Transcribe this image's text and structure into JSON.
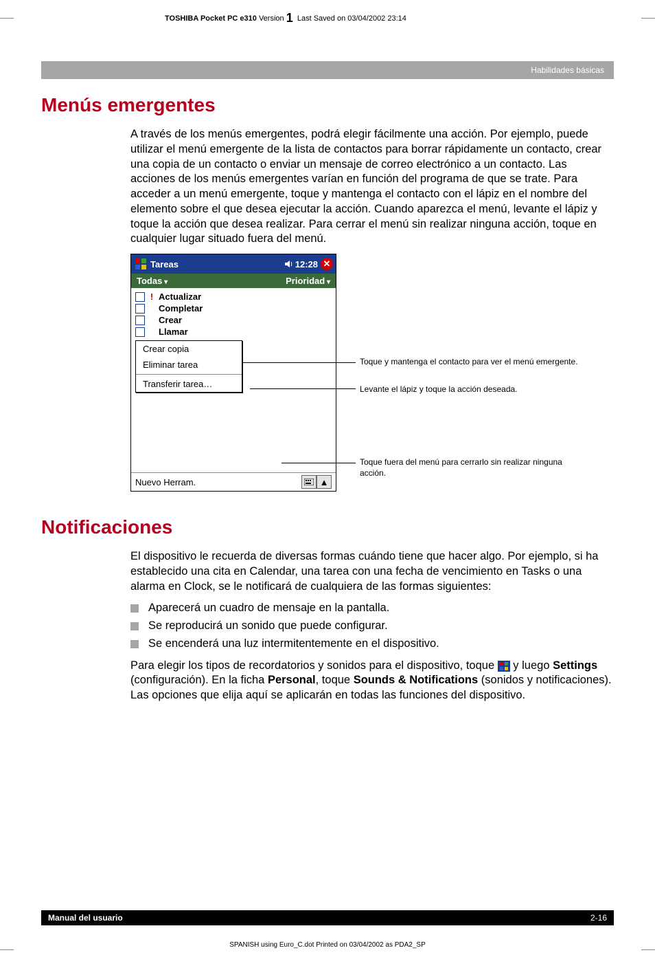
{
  "header": {
    "product": "TOSHIBA Pocket PC e310",
    "version_label": "Version",
    "version_big": "1",
    "saved": "Last Saved on 03/04/2002 23:14"
  },
  "breadcrumb": "Habilidades básicas",
  "section1": {
    "title": "Menús emergentes",
    "para": "A través de los menús emergentes, podrá elegir fácilmente una acción. Por ejemplo, puede utilizar el menú emergente de la lista de contactos para borrar rápidamente un contacto, crear una copia de un contacto o enviar un mensaje de correo electrónico a un contacto. Las acciones de los menús emergentes varían en función del programa de que se trate. Para acceder a un menú emergente, toque y mantenga el contacto con el lápiz en el nombre del elemento sobre el que desea ejecutar la acción. Cuando aparezca el menú, levante el lápiz y toque la acción que desea realizar. Para cerrar el menú sin realizar ninguna acción, toque en cualquier lugar situado fuera del menú."
  },
  "device": {
    "title": "Tareas",
    "time": "12:28",
    "filter_left": "Todas",
    "filter_right": "Prioridad",
    "tasks": [
      "Actualizar",
      "Completar",
      "Crear",
      "Llamar"
    ],
    "menu": {
      "items": [
        "Crear copia",
        "Eliminar tarea",
        "Transferir tarea…"
      ]
    },
    "bottom_left": "Nuevo",
    "bottom_right": "Herram."
  },
  "callouts": {
    "c1": "Toque y mantenga el contacto para ver el menú emergente.",
    "c2": "Levante el lápiz y toque la acción deseada.",
    "c3": "Toque fuera del menú para cerrarlo sin realizar ninguna acción."
  },
  "section2": {
    "title": "Notificaciones",
    "para1": "El dispositivo le recuerda de diversas formas cuándo tiene que hacer algo. Por ejemplo, si ha establecido una cita en Calendar, una tarea con una fecha de vencimiento en Tasks o una alarma en Clock, se le notificará de cualquiera de las formas siguientes:",
    "bullets": [
      "Aparecerá un cuadro de mensaje en la pantalla.",
      "Se reproducirá un sonido que puede configurar.",
      "Se encenderá una luz intermitentemente en el dispositivo."
    ],
    "para2_pre": "Para elegir los tipos de recordatorios y sonidos para el dispositivo, toque ",
    "para2_mid1": " y luego ",
    "para2_b1": "Settings",
    "para2_mid2": " (configuración). En la ficha ",
    "para2_b2": "Personal",
    "para2_mid3": ", toque ",
    "para2_b3": "Sounds & Notifications",
    "para2_post": " (sonidos y notificaciones). Las opciones que elija aquí se aplicarán en todas las funciones del dispositivo."
  },
  "footer": {
    "left": "Manual del usuario",
    "right": "2-16"
  },
  "print_line": "SPANISH using Euro_C.dot  Printed on 03/04/2002 as PDA2_SP"
}
